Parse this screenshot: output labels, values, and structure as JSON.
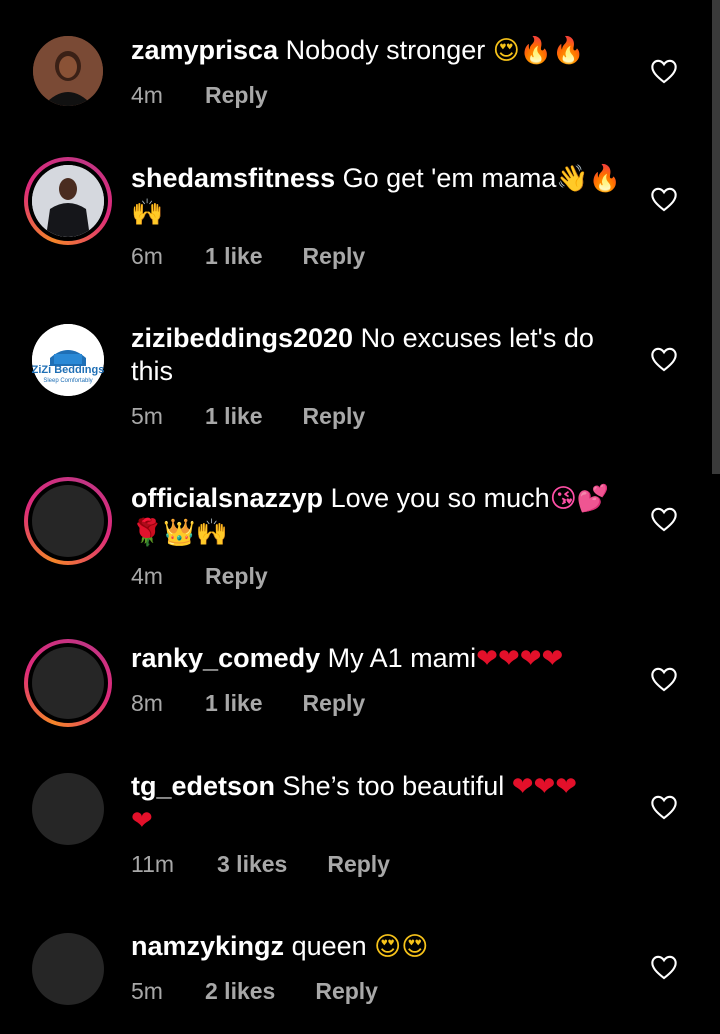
{
  "comments": [
    {
      "username": "zamyprisca",
      "text": "Nobody stronger",
      "emoji": "😍🔥🔥",
      "time": "4m",
      "likes": "",
      "reply": "Reply",
      "avatar": "photo",
      "story_ring": false
    },
    {
      "username": "shedamsfitness",
      "text": "Go get 'em mama",
      "emoji": "👋🔥",
      "emoji2": "🙌",
      "time": "6m",
      "likes": "1 like",
      "reply": "Reply",
      "avatar": "photo",
      "story_ring": true
    },
    {
      "username": "zizibeddings2020",
      "text": "No excuses let's do",
      "text2": "this",
      "time": "5m",
      "likes": "1 like",
      "reply": "Reply",
      "avatar": "logo",
      "logo_text": "ZiZi Beddings",
      "logo_sub": "Sleep Comfortably",
      "story_ring": false
    },
    {
      "username": "officialsnazzyp",
      "text": "Love you so much",
      "emoji": "😘💕",
      "emoji2": "🌹👑🙌",
      "time": "4m",
      "likes": "",
      "reply": "Reply",
      "avatar": "blank",
      "story_ring": true
    },
    {
      "username": "ranky_comedy",
      "text": "My A1 mami",
      "emoji": "❤❤❤❤",
      "time": "8m",
      "likes": "1 like",
      "reply": "Reply",
      "avatar": "blank",
      "story_ring": true
    },
    {
      "username": "tg_edetson",
      "text": "She’s too beautiful",
      "emoji": "❤❤❤",
      "emoji2": "❤",
      "time": "11m",
      "likes": "3 likes",
      "reply": "Reply",
      "avatar": "blank",
      "story_ring": false
    },
    {
      "username": "namzykingz",
      "text": "queen",
      "emoji": "😍😍",
      "time": "5m",
      "likes": "2 likes",
      "reply": "Reply",
      "avatar": "blank",
      "story_ring": false
    }
  ],
  "colors": {
    "background": "#000000",
    "text": "#ffffff",
    "meta": "#a8a8a8",
    "avatar_placeholder": "#262626"
  },
  "icons": {
    "like": "heart-outline-icon"
  }
}
